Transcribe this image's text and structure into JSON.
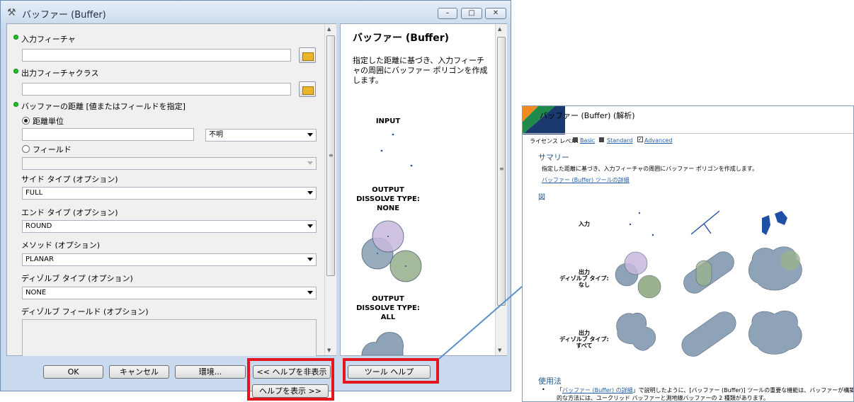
{
  "window": {
    "title": "バッファー (Buffer)",
    "controls": {
      "minimize": "–",
      "maximize": "□",
      "close": "✕"
    }
  },
  "form": {
    "input_label": "入力フィーチャ",
    "output_label": "出力フィーチャクラス",
    "distance_label": "バッファーの距離 [値またはフィールドを指定]",
    "linear_unit_label": "距離単位",
    "unit_value": "不明",
    "field_label": "フィールド",
    "side_label": "サイド タイプ (オプション)",
    "side_value": "FULL",
    "end_label": "エンド タイプ (オプション)",
    "end_value": "ROUND",
    "method_label": "メソッド (オプション)",
    "method_value": "PLANAR",
    "dissolve_label": "ディゾルブ タイプ (オプション)",
    "dissolve_value": "NONE",
    "dissolve_field_label": "ディゾルブ フィールド (オプション)"
  },
  "buttons": {
    "ok": "OK",
    "cancel": "キャンセル",
    "env": "環境...",
    "hide_help": "<< ヘルプを非表示",
    "show_help": "ヘルプを表示 >>",
    "tool_help": "ツール ヘルプ"
  },
  "help_pane": {
    "title": "バッファー (Buffer)",
    "desc": "指定した距離に基づき、入力フィーチャの周囲にバッファー ポリゴンを作成します。",
    "cap_input": "INPUT",
    "cap_out_none_1": "OUTPUT",
    "cap_out_none_2": "DISSOLVE TYPE:",
    "cap_out_none_3": "NONE",
    "cap_out_all_1": "OUTPUT",
    "cap_out_all_2": "DISSOLVE TYPE:",
    "cap_out_all_3": "ALL"
  },
  "doc": {
    "title": "バッファー (Buffer) (解析)",
    "license_label": "ライセンス レベル:",
    "license_basic": "Basic",
    "license_standard": "Standard",
    "license_advanced": "Advanced",
    "summary_heading": "サマリー",
    "summary_text": "指定した距離に基づき、入力フィーチャの周囲にバッファー ポリゴンを作成します。",
    "summary_link": "バッファー (Buffer) ツールの詳細",
    "figure_heading": "図",
    "row_input": "入力",
    "row_none_1": "出力",
    "row_none_2": "ディゾルブ タイプ:",
    "row_none_3": "なし",
    "row_all_1": "出力",
    "row_all_2": "ディゾルブ タイプ:",
    "row_all_3": "すべて",
    "usage_heading": "使用法",
    "usage_q_open": "「",
    "usage_link": "バッファー (Buffer) の詳細",
    "usage_line1_rest": "」で説明したように、[バッファー (Buffer)] ツールの重要な機能は、バッファーが構築される方",
    "usage_line2": "的な方法には、ユークリッド バッファーと測地線バッファーの 2 種類があります。"
  },
  "colors": {
    "highlight_red": "#e3161e",
    "connector_blue": "#5b8fc8",
    "buffer_gray_blue": "#8ea3b7",
    "buffer_green": "#9bb28f",
    "buffer_purple": "#c8b9dd",
    "feature_dark_blue": "#1f4fa6"
  }
}
